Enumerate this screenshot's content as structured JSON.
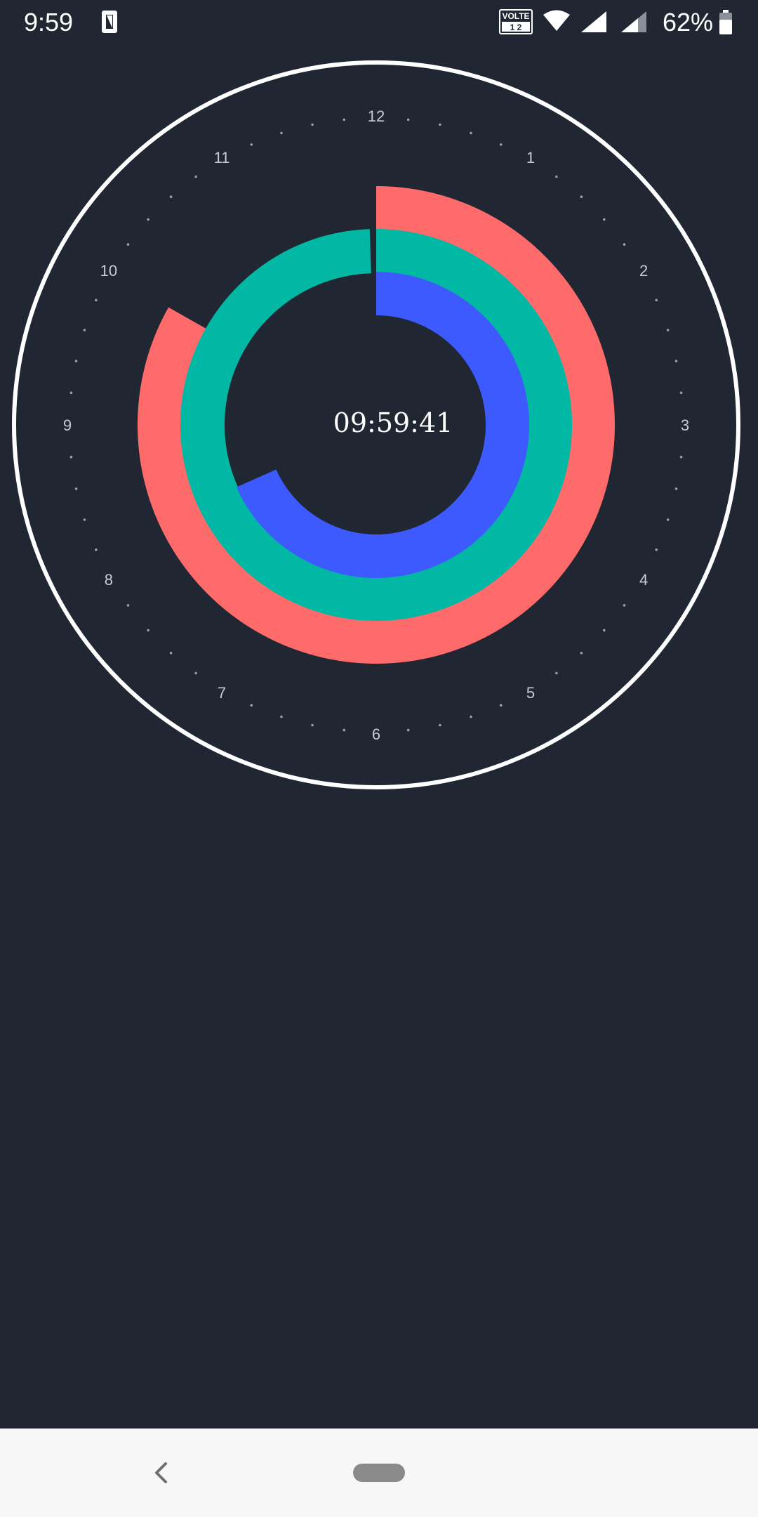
{
  "status_bar": {
    "time": "9:59",
    "battery_percent": "62%",
    "volte_label": "VOLTE",
    "sim_slots": "1 2",
    "icons": [
      "sim-card-icon",
      "volte-icon",
      "wifi-icon",
      "signal-icon",
      "signal-icon",
      "battery-icon"
    ]
  },
  "clock": {
    "digital_time": "09:59:41",
    "hour_numbers": [
      "12",
      "1",
      "2",
      "3",
      "4",
      "5",
      "6",
      "7",
      "8",
      "9",
      "10",
      "11"
    ],
    "hours": 9,
    "minutes": 59,
    "seconds": 41,
    "colors": {
      "background": "#202632",
      "outer_ring": "#ffffff",
      "hour_ring": "#ff6b6b",
      "minute_ring": "#00b8a3",
      "second_ring": "#3d5afe",
      "numbers": "#c7cbd3",
      "ticks": "#9aa0ab",
      "digital_text": "#ffffff"
    }
  },
  "nav_bar": {
    "icons": [
      "back-chevron-icon",
      "home-pill-icon"
    ]
  }
}
